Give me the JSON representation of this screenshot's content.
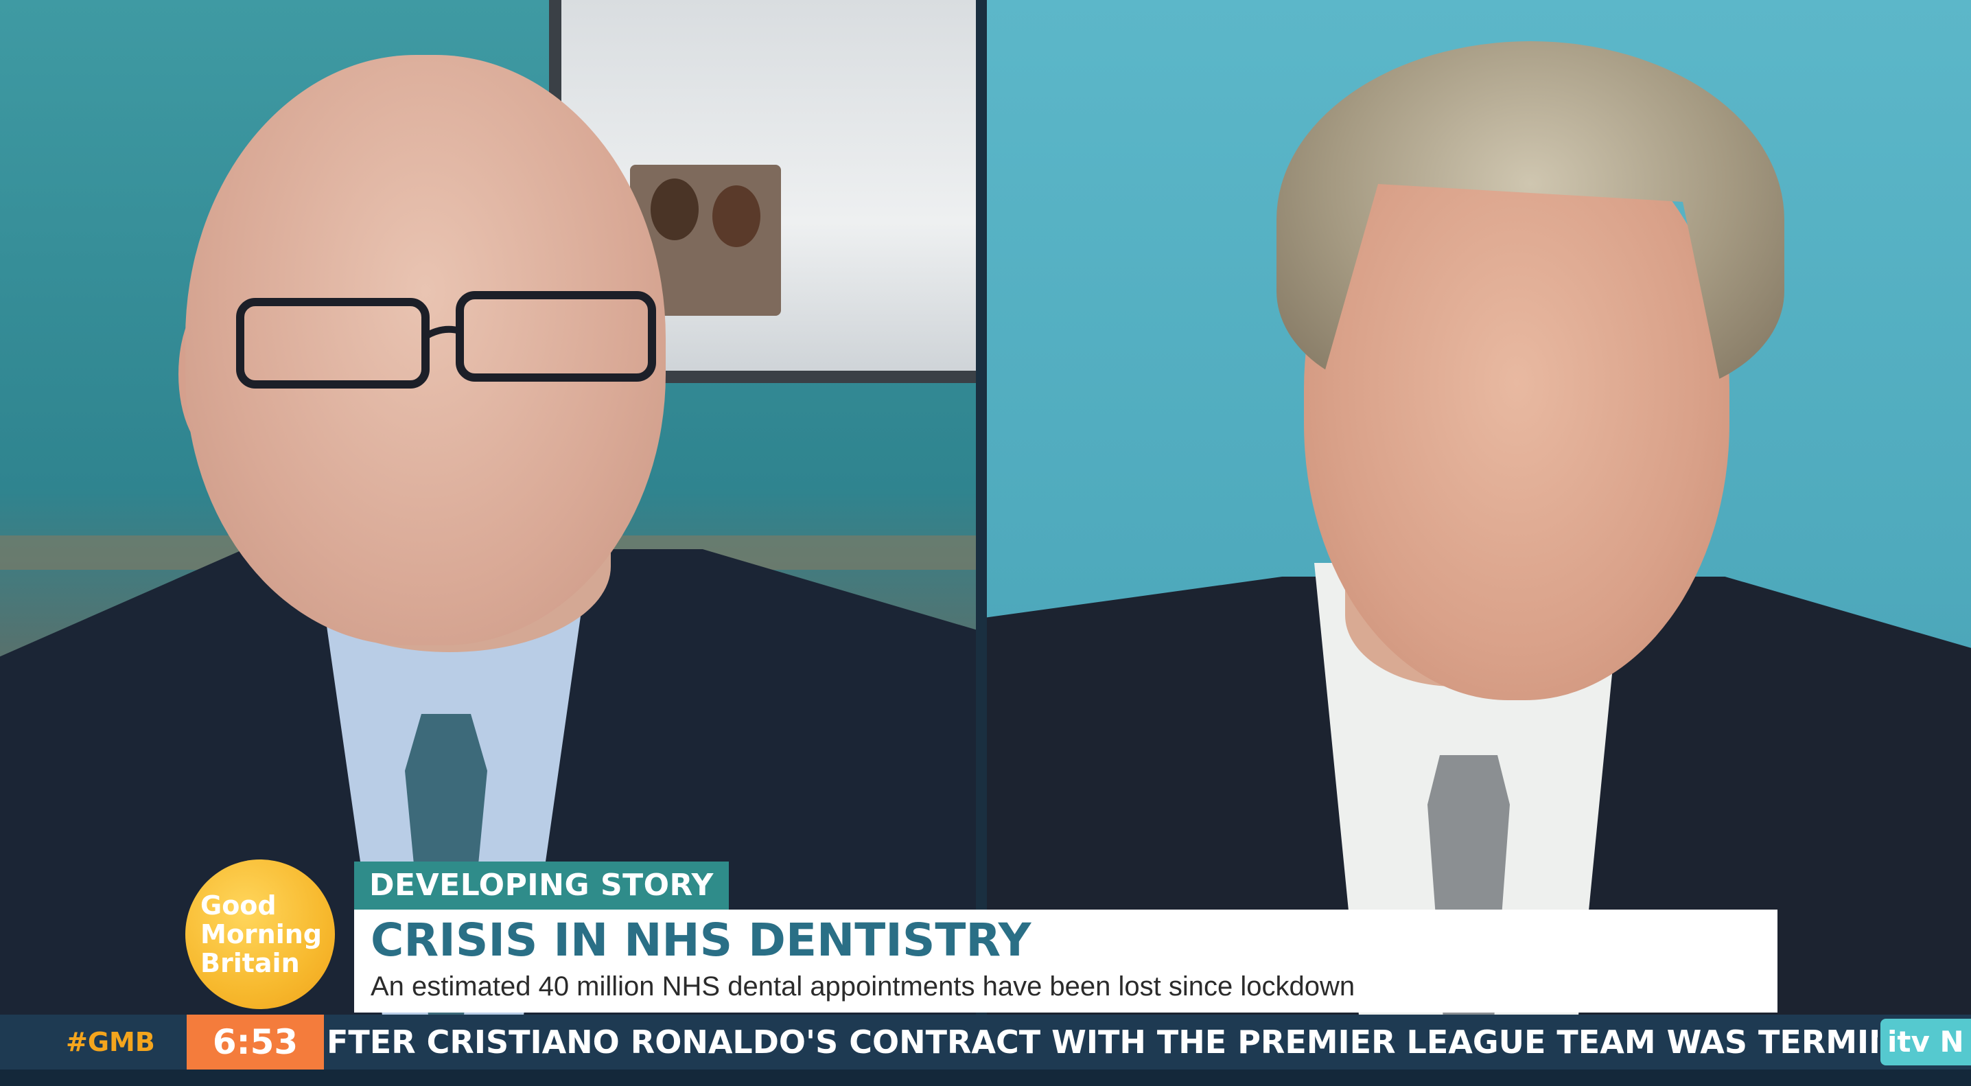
{
  "logo": {
    "line1": "Good",
    "line2": "Morning",
    "line3": "Britain",
    "color": "#f7b92e"
  },
  "lower_third": {
    "tag": "DEVELOPING STORY",
    "headline": "CRISIS IN NHS DENTISTRY",
    "subline": "An estimated 40 million NHS dental appointments have been lost since lockdown",
    "tag_color": "#2f8c8a",
    "headline_color": "#2a6f86"
  },
  "ticker": {
    "hashtag": "#GMB",
    "time": "6:53",
    "text": "FTER CRISTIANO RONALDO'S CONTRACT WITH THE PREMIER LEAGUE TEAM WAS TERMINATED",
    "channel": "itv N",
    "clock_color": "#f47c3c",
    "bar_color": "#1e3a52"
  }
}
